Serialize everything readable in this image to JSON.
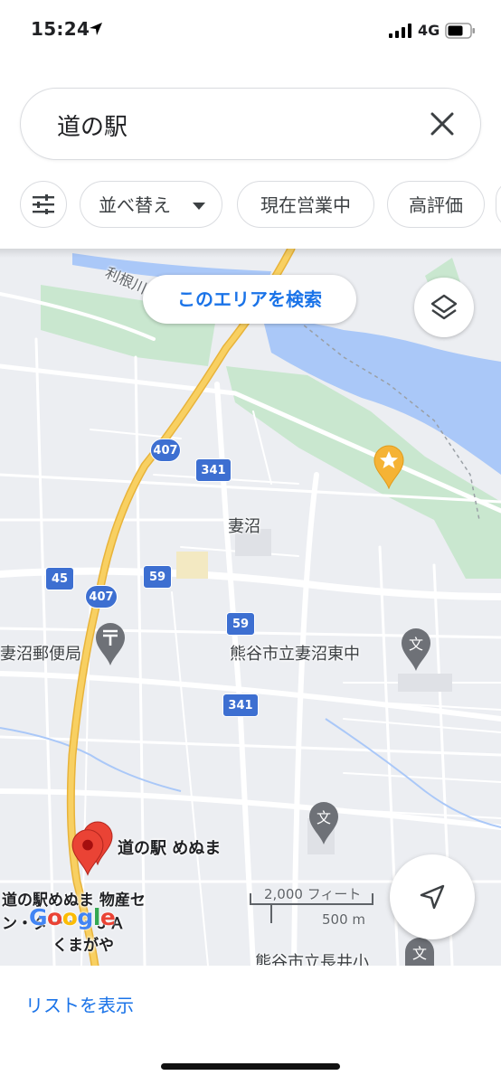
{
  "status_bar": {
    "time": "15:24",
    "network": "4G"
  },
  "search": {
    "query": "道の駅"
  },
  "chips": {
    "sort_label": "並べ替え",
    "open_now_label": "現在営業中",
    "top_rated_label": "高評価"
  },
  "map": {
    "search_area_label": "このエリアを検索",
    "labels": {
      "river": "利根川",
      "menuma": "妻沼",
      "post_office": "妻沼郵便局",
      "school_1": "熊谷市立妻沼東中",
      "school_2": "熊谷市立長井小",
      "michinoeki": "道の駅 めぬま",
      "michinoeki_2_line1": "道の駅めぬま 物産セ",
      "michinoeki_2_line2": "ン・ター・・ＪＡ",
      "michinoeki_2_line3": "くまがや"
    },
    "road_shields": {
      "r407_a": "407",
      "r341_a": "341",
      "r45": "45",
      "r59_a": "59",
      "r407_b": "407",
      "r59_b": "59",
      "r341_b": "341"
    },
    "scale": {
      "feet": "2,000 フィート",
      "meters": "500 m"
    },
    "attribution": {
      "g1": "G",
      "o1": "o",
      "o2": "o",
      "g2": "g",
      "l": "l",
      "e": "e"
    }
  },
  "bottom": {
    "list_label": "リストを表示"
  },
  "colors": {
    "accent": "#1a73e8",
    "water": "#aac8f8",
    "park": "#c9e7cf",
    "highway": "#f6c34f",
    "pin": "#ea4335"
  }
}
